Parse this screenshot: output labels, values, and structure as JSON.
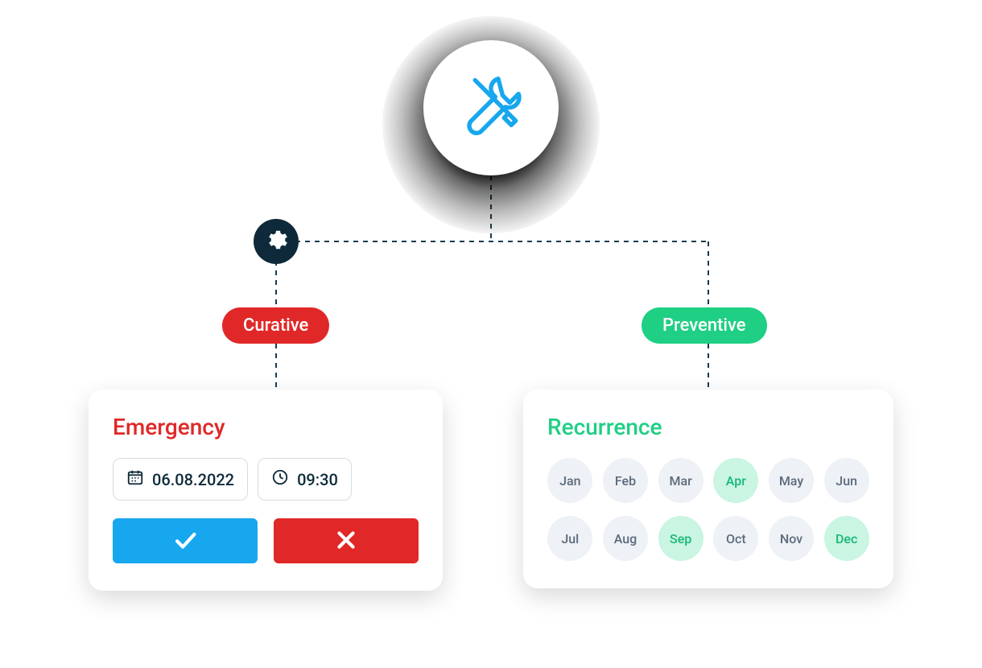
{
  "root_icon": "tools-crossed-icon",
  "gear_icon": "gear-icon",
  "colors": {
    "curative": "#e02828",
    "preventive": "#1fcf84",
    "confirm": "#17a7ef",
    "cancel": "#e02828",
    "dark": "#0e2a3a"
  },
  "branches": {
    "curative": {
      "pill_label": "Curative",
      "card_title": "Emergency",
      "date": {
        "icon": "calendar-icon",
        "value": "06.08.2022"
      },
      "time": {
        "icon": "clock-icon",
        "value": "09:30"
      },
      "actions": {
        "confirm_icon": "check-icon",
        "cancel_icon": "x-icon"
      }
    },
    "preventive": {
      "pill_label": "Preventive",
      "card_title": "Recurrence",
      "months": [
        {
          "label": "Jan",
          "selected": false
        },
        {
          "label": "Feb",
          "selected": false
        },
        {
          "label": "Mar",
          "selected": false
        },
        {
          "label": "Apr",
          "selected": true
        },
        {
          "label": "May",
          "selected": false
        },
        {
          "label": "Jun",
          "selected": false
        },
        {
          "label": "Jul",
          "selected": false
        },
        {
          "label": "Aug",
          "selected": false
        },
        {
          "label": "Sep",
          "selected": true
        },
        {
          "label": "Oct",
          "selected": false
        },
        {
          "label": "Nov",
          "selected": false
        },
        {
          "label": "Dec",
          "selected": true
        }
      ]
    }
  }
}
